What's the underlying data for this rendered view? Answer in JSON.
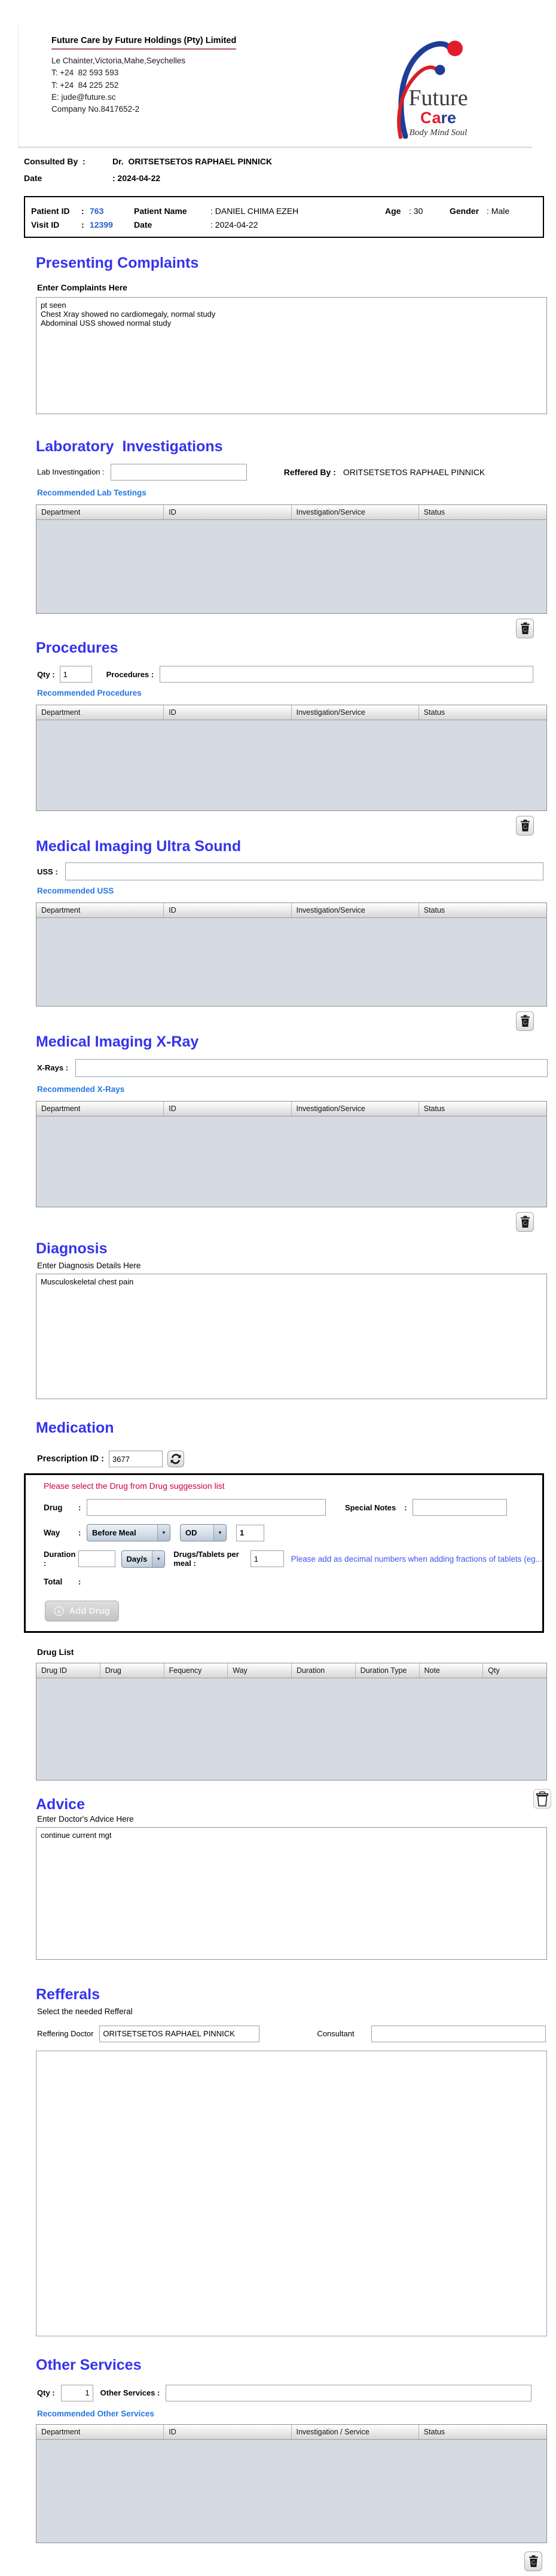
{
  "colors": {
    "heading_blue": "#3533ee",
    "link_blue": "#2277e0",
    "id_blue": "#2b5fd0",
    "alert_red": "#cc0040",
    "note_blue": "#3a55f0",
    "logo_blue": "#1e3d96",
    "logo_red": "#e51b2c",
    "table_body_gray": "#d6dae2"
  },
  "icons": {
    "dropdown_arrow": "▼",
    "plus": "+",
    "heart": "♥"
  },
  "letterhead": {
    "company_title": "Future Care by Future Holdings (Pty) Limited",
    "address": "Le Chainter,Victoria,Mahe,Seychelles",
    "phone1": "T: +24  82 593 593",
    "phone2": "T: +24  84 225 252",
    "email": "E: jude@future.sc",
    "company_no": "Company No.8417652-2",
    "logo": {
      "word1": "Future",
      "word2_ca": "Ca",
      "word2_re": "re",
      "tagline": "Body Mind Soul"
    }
  },
  "consult": {
    "label": "Consulted By  :",
    "value": "Dr.  ORITSETSETOS RAPHAEL PINNICK",
    "date_label": "Date",
    "date_value": ": 2024-04-22"
  },
  "patient_bar": {
    "patient_id_label": "Patient ID",
    "colon": ":",
    "patient_id_value": "763",
    "patient_name_label": "Patient Name",
    "patient_name_value": ": DANIEL CHIMA EZEH",
    "age_label": "Age",
    "age_value": ": 30",
    "gender_label": "Gender",
    "gender_value": ": Male",
    "visit_id_label": "Visit ID",
    "visit_id_value": "12399",
    "date_label": "Date",
    "date_value": ": 2024-04-22"
  },
  "complaints": {
    "heading": "Presenting Complaints",
    "label": "Enter Complaints Here",
    "text": "pt seen\nChest Xray showed no cardiomegaly, normal study\nAbdominal USS showed normal study"
  },
  "lab": {
    "heading": "Laboratory  Investigations",
    "input_label": "Lab Investingation :",
    "referred_label": "Reffered By :",
    "referred_value": "ORITSETSETOS RAPHAEL PINNICK",
    "link": "Recommended Lab Testings",
    "table_headers": [
      "Department",
      "ID",
      "Investigation/Service",
      "Status"
    ]
  },
  "procedures": {
    "heading": "Procedures",
    "qty_label": "Qty :",
    "qty_value": "1",
    "input_label": "Procedures :",
    "link": "Recommended Procedures",
    "table_headers": [
      "Department",
      "ID",
      "Investigation/Service",
      "Status"
    ]
  },
  "uss": {
    "heading": "Medical Imaging Ultra Sound",
    "input_label": "USS :",
    "link": "Recommended USS",
    "table_headers": [
      "Department",
      "ID",
      "Investigation/Service",
      "Status"
    ]
  },
  "xray": {
    "heading": "Medical Imaging X-Ray",
    "input_label": "X-Rays :",
    "link": "Recommended X-Rays",
    "table_headers": [
      "Department",
      "ID",
      "Investigation/Service",
      "Status"
    ]
  },
  "diagnosis": {
    "heading": "Diagnosis",
    "label": "Enter Diagnosis Details Here",
    "text": "Musculoskeletal chest pain"
  },
  "medication": {
    "heading": "Medication",
    "prescription_label": "Prescription ID :",
    "prescription_value": "3677",
    "red_note": "Please select the Drug from Drug suggession list",
    "drug_label": "Drug",
    "colon": ":",
    "special_notes_label": "Special Notes",
    "way_label": "Way",
    "way_option1": "Before Meal",
    "way_option2": "OD",
    "way_qty_value": "1",
    "duration_label": "Duration :",
    "duration_unit": "Day/s",
    "per_meal_label": "Drugs/Tablets per meal :",
    "per_meal_value": "1",
    "blue_note": "Please add as decimal numbers when adding fractions of tablets (eg...",
    "total_label": "Total",
    "add_drug_label": "Add Drug",
    "drug_list_label": "Drug List",
    "drug_table_headers": [
      "Drug ID",
      "Drug",
      "Fequency",
      "Way",
      "Duration",
      "Duration Type",
      "Note",
      "Qty"
    ]
  },
  "advice": {
    "heading": "Advice",
    "label": "Enter Doctor's Advice Here",
    "text": "continue current mgt"
  },
  "refferals": {
    "heading": "Refferals",
    "sub_label": "Select the needed Refferal",
    "referring_label": "Reffering Doctor",
    "referring_value": "ORITSETSETOS RAPHAEL PINNICK",
    "consultant_label": "Consultant"
  },
  "other_services": {
    "heading": "Other Services",
    "qty_label": "Qty :",
    "qty_value": "1",
    "input_label": "Other Services :",
    "link": "Recommended Other Services",
    "table_headers": [
      "Department",
      "ID",
      "Investigation / Service",
      "Status"
    ]
  }
}
